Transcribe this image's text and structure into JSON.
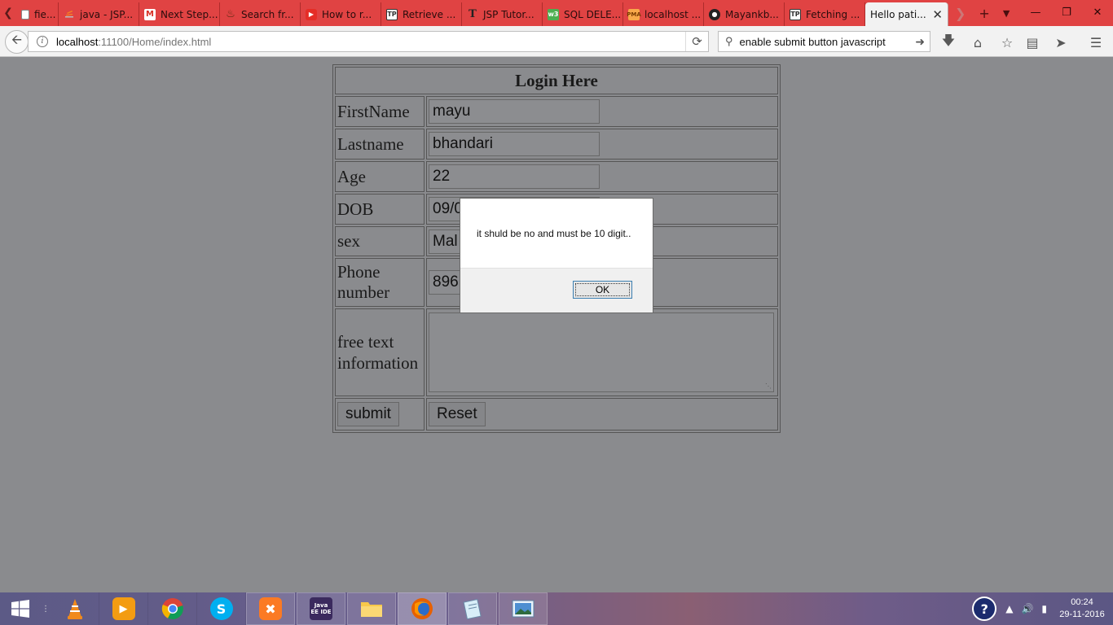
{
  "browser": {
    "tabs": [
      {
        "label": "fie...",
        "icon": "page-icon"
      },
      {
        "label": "java - JSP...",
        "icon": "stackoverflow-icon"
      },
      {
        "label": "Next Step...",
        "icon": "gmail-icon"
      },
      {
        "label": "Search fr...",
        "icon": "java-icon"
      },
      {
        "label": "How to r...",
        "icon": "youtube-icon"
      },
      {
        "label": "Retrieve ...",
        "icon": "tutorialspoint-icon"
      },
      {
        "label": "JSP Tutor...",
        "icon": "t-icon"
      },
      {
        "label": "SQL DELE...",
        "icon": "w3schools-icon"
      },
      {
        "label": "localhost ...",
        "icon": "phpmyadmin-icon"
      },
      {
        "label": "Mayankb...",
        "icon": "github-icon"
      },
      {
        "label": "Fetching ...",
        "icon": "tutorialspoint-icon"
      },
      {
        "label": "Hello pati...",
        "icon": "none",
        "active": true
      }
    ],
    "url_host": "localhost",
    "url_path": ":11100/Home/index.html",
    "search_value": "enable submit button javascript",
    "accent_color": "#e04343"
  },
  "form": {
    "title": "Login Here",
    "rows": [
      {
        "label": "FirstName",
        "value": "mayu"
      },
      {
        "label": "Lastname",
        "value": "bhandari"
      },
      {
        "label": "Age",
        "value": "22"
      },
      {
        "label": "DOB",
        "value": "09/0"
      },
      {
        "label": "sex",
        "value": "Mal"
      },
      {
        "label_line1": "Phone",
        "label_line2": "number",
        "value": "896"
      }
    ],
    "freetext_line1": "free text",
    "freetext_line2": "information",
    "freetext_value": "",
    "submit_label": "submit",
    "reset_label": "Reset"
  },
  "alert": {
    "message": "it shuld be no and must be 10 digit..",
    "ok_label": "OK"
  },
  "taskbar": {
    "apps": [
      {
        "name": "vlc-icon"
      },
      {
        "name": "media-player-icon"
      },
      {
        "name": "chrome-icon"
      },
      {
        "name": "skype-icon"
      },
      {
        "name": "xampp-icon",
        "pinned": true
      },
      {
        "name": "java-ee-ide-icon",
        "pinned": true,
        "text": "Java EE IDE"
      },
      {
        "name": "file-explorer-icon",
        "pinned": true
      },
      {
        "name": "firefox-icon",
        "pinned": true,
        "active": true
      },
      {
        "name": "notepad-icon",
        "pinned": true
      },
      {
        "name": "photos-icon",
        "pinned": true
      }
    ],
    "clock_time": "00:24",
    "clock_date": "29-11-2016"
  }
}
